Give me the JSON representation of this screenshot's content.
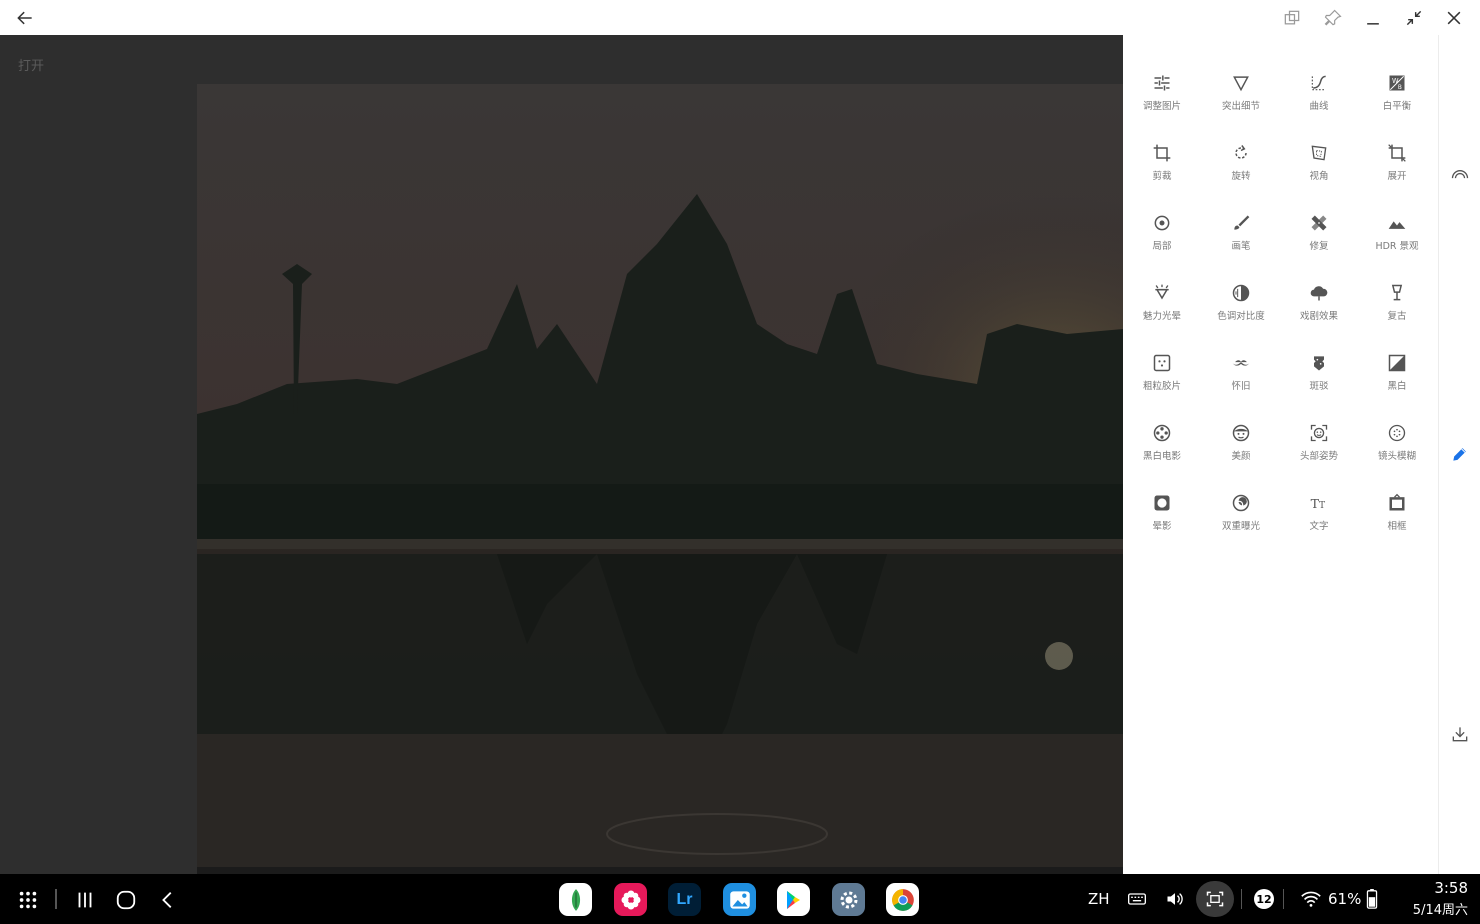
{
  "titlebar": {
    "icons": [
      "back-arrow-icon",
      "multi-window-icon",
      "pin-icon",
      "minimize-icon",
      "shrink-icon",
      "close-icon"
    ]
  },
  "canvas": {
    "open_label": "打开"
  },
  "tools": [
    {
      "label": "调整图片",
      "icon": "tune-sliders-icon"
    },
    {
      "label": "突出细节",
      "icon": "triangle-details-icon"
    },
    {
      "label": "曲线",
      "icon": "curves-icon"
    },
    {
      "label": "白平衡",
      "icon": "white-balance-icon"
    },
    {
      "label": "剪裁",
      "icon": "crop-icon"
    },
    {
      "label": "旋转",
      "icon": "rotate-icon"
    },
    {
      "label": "视角",
      "icon": "perspective-icon"
    },
    {
      "label": "展开",
      "icon": "expand-icon"
    },
    {
      "label": "局部",
      "icon": "selective-icon"
    },
    {
      "label": "画笔",
      "icon": "brush-icon"
    },
    {
      "label": "修复",
      "icon": "healing-icon"
    },
    {
      "label": "HDR 景观",
      "icon": "hdr-mountain-icon"
    },
    {
      "label": "魅力光晕",
      "icon": "glamour-glow-icon"
    },
    {
      "label": "色调对比度",
      "icon": "tonal-contrast-icon"
    },
    {
      "label": "戏剧效果",
      "icon": "drama-cloud-icon"
    },
    {
      "label": "复古",
      "icon": "vintage-lamp-icon"
    },
    {
      "label": "粗粒胶片",
      "icon": "grainy-film-icon"
    },
    {
      "label": "怀旧",
      "icon": "retrolux-mustache-icon"
    },
    {
      "label": "斑驳",
      "icon": "grunge-icon"
    },
    {
      "label": "黑白",
      "icon": "black-white-icon"
    },
    {
      "label": "黑白电影",
      "icon": "noir-film-reel-icon"
    },
    {
      "label": "美颜",
      "icon": "face-glamour-icon"
    },
    {
      "label": "头部姿势",
      "icon": "head-pose-icon"
    },
    {
      "label": "镜头模糊",
      "icon": "lens-blur-icon"
    },
    {
      "label": "晕影",
      "icon": "vignette-icon"
    },
    {
      "label": "双重曝光",
      "icon": "double-exposure-icon"
    },
    {
      "label": "文字",
      "icon": "text-tt-icon"
    },
    {
      "label": "相框",
      "icon": "frames-icon"
    }
  ],
  "side_rail": {
    "icons": [
      "looks-rainbow-icon",
      "edit-pencil-icon",
      "export-download-icon"
    ],
    "accent": "#1a73e8"
  },
  "taskbar": {
    "dock_apps": [
      "snapseed-app-icon",
      "blossom-app-icon",
      "lightroom-app-icon",
      "gallery-app-icon",
      "play-store-app-icon",
      "settings-app-icon",
      "chrome-app-icon"
    ],
    "lightroom_text": "Lr",
    "language": "ZH",
    "notification_count": "12",
    "battery": "61%",
    "time": "3:58",
    "date": "5/14周六"
  }
}
